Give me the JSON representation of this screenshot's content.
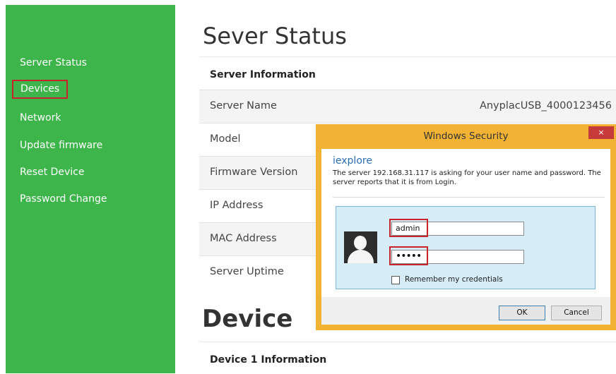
{
  "sidebar": {
    "items": [
      {
        "label": "Server Status"
      },
      {
        "label": "Devices"
      },
      {
        "label": "Network"
      },
      {
        "label": "Update firmware"
      },
      {
        "label": "Reset Device"
      },
      {
        "label": "Password Change"
      }
    ]
  },
  "main": {
    "title": "Sever Status",
    "server_info_header": "Server Information",
    "rows": [
      {
        "label": "Server Name",
        "value": "AnyplacUSB_4000123456"
      },
      {
        "label": "Model",
        "value": ""
      },
      {
        "label": "Firmware Version",
        "value": ""
      },
      {
        "label": "IP Address",
        "value": ""
      },
      {
        "label": "MAC Address",
        "value": ""
      },
      {
        "label": "Server Uptime",
        "value": ""
      }
    ],
    "device_title": "Device",
    "device_info_header": "Device 1 Information"
  },
  "dialog": {
    "title": "Windows Security",
    "close_icon": "×",
    "app_name": "iexplore",
    "message": "The server 192.168.31.117 is asking for your user name and password. The server reports that it is from Login.",
    "username_value": "admin",
    "password_value": "•••••",
    "remember_label": "Remember my credentials",
    "remember_checked": false,
    "ok_label": "OK",
    "cancel_label": "Cancel"
  },
  "colors": {
    "sidebar_bg": "#3db54a",
    "highlight": "#c8222a",
    "dialog_frame": "#f2b233",
    "close_button": "#c63a3a"
  },
  "icons": {
    "avatar": "user-avatar-icon",
    "close": "close-icon",
    "checkbox": "checkbox-icon"
  }
}
